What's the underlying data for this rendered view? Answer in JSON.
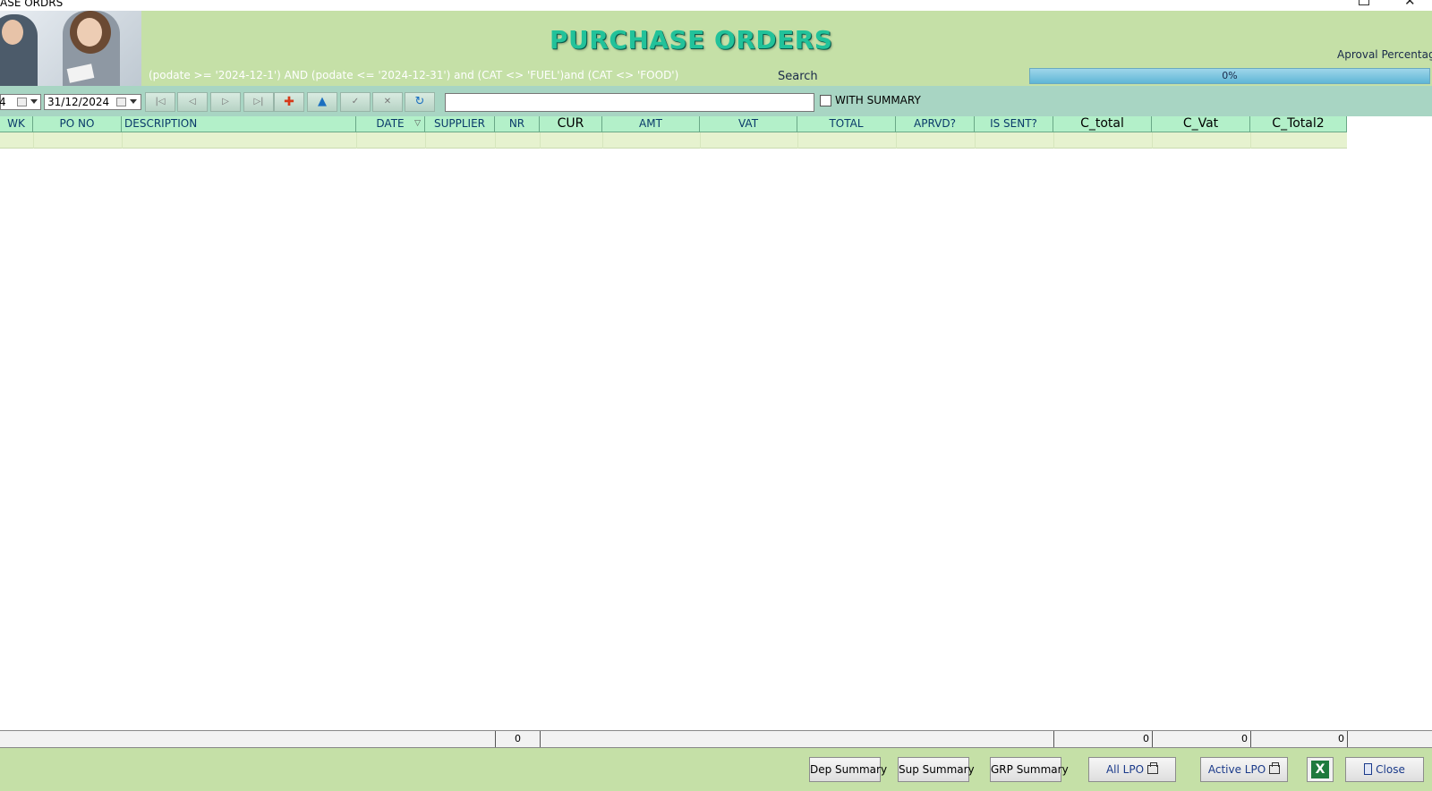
{
  "window": {
    "title": "ASE ORDRS"
  },
  "header": {
    "title": "PURCHASE ORDERS",
    "filter_expression": "(podate >= '2024-12-1') AND  (podate  <= '2024-12-31') and (CAT  <> 'FUEL')and (CAT <> 'FOOD')",
    "search_label": "Search",
    "approval_label": "Aproval Percentage",
    "approval_progress": {
      "value": 0,
      "text": "0%"
    }
  },
  "toolbar": {
    "date_from": "4",
    "date_to": "31/12/2024",
    "search_value": "",
    "with_summary_label": "WITH SUMMARY",
    "with_summary_checked": false,
    "nav_icons": [
      "first-record-icon",
      "prior-record-icon",
      "next-record-icon",
      "last-record-icon",
      "insert-record-icon",
      "edit-record-icon",
      "post-record-icon",
      "cancel-record-icon",
      "refresh-icon"
    ]
  },
  "grid": {
    "columns": [
      "WK",
      "PO NO",
      "DESCRIPTION",
      "DATE",
      "SUPPLIER",
      "NR",
      "CUR",
      "AMT",
      "VAT",
      "TOTAL",
      "APRVD?",
      "IS SENT?",
      "C_total",
      "C_Vat",
      "C_Total2"
    ],
    "rows": []
  },
  "footer": {
    "nr_sum": "0",
    "c_total_sum": "0",
    "c_vat_sum": "0",
    "c_total2_sum": "0"
  },
  "buttons": {
    "dep_summary": "Dep Summary",
    "sup_summary": "Sup Summary",
    "grp_summary": "GRP Summary",
    "all_lpo": "All LPO",
    "active_lpo": "Active LPO",
    "close": "Close"
  }
}
